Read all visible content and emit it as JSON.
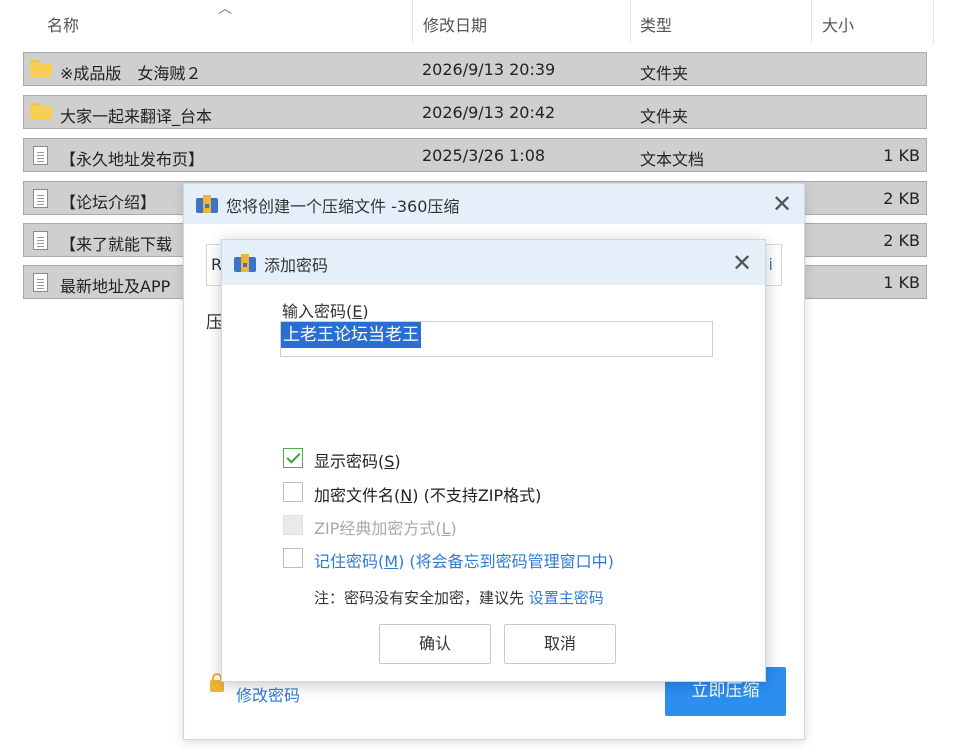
{
  "explorer": {
    "columns": {
      "name": "名称",
      "modified": "修改日期",
      "type": "类型",
      "size": "大小"
    },
    "files": [
      {
        "icon": "folder-icon",
        "name": "※成品版　女海贼２",
        "modified": "2026/9/13 20:39",
        "type": "文件夹",
        "size": ""
      },
      {
        "icon": "folder-icon",
        "name": "大家一起来翻译_台本",
        "modified": "2026/9/13 20:42",
        "type": "文件夹",
        "size": ""
      },
      {
        "icon": "document-icon",
        "name": "【永久地址发布页】",
        "modified": "2025/3/26 1:08",
        "type": "文本文档",
        "size": "1 KB"
      },
      {
        "icon": "document-icon",
        "name": "【论坛介绍】",
        "modified": "",
        "type": "",
        "size": "2 KB"
      },
      {
        "icon": "document-icon",
        "name": "【来了就能下载",
        "modified": "",
        "type": "",
        "size": "2 KB"
      },
      {
        "icon": "document-icon",
        "name": "最新地址及APP",
        "modified": "",
        "type": "",
        "size": "1 KB"
      }
    ]
  },
  "compress_dialog": {
    "title": "您将创建一个压缩文件 -360压缩",
    "input_visible_start": "R",
    "input_visible_end": "i",
    "side_label_fragment": "压",
    "change_password_link": "修改密码",
    "compress_now_button": "立即压缩"
  },
  "password_dialog": {
    "title": "添加密码",
    "password_label": "输入密码",
    "password_label_key": "E",
    "password_value": "上老王论坛当老王",
    "options": {
      "show_password": {
        "label": "显示密码",
        "key": "S",
        "checked": true
      },
      "encrypt_filenames": {
        "label": "加密文件名",
        "key": "N",
        "suffix": " (不支持ZIP格式)",
        "checked": false
      },
      "zip_classic": {
        "label": "ZIP经典加密方式",
        "key": "L",
        "checked": false,
        "disabled": true
      },
      "remember_password": {
        "label": "记住密码",
        "key": "M",
        "suffix": " (将会备忘到密码管理窗口中)",
        "checked": false
      }
    },
    "note_text": "注：密码没有安全加密，建议先 ",
    "note_link": "设置主密码",
    "ok_button": "确认",
    "cancel_button": "取消"
  },
  "colors": {
    "accent": "#2c8ff0",
    "link": "#2e7bd1",
    "title_bar": "#e4effa",
    "selection": "#2a6ed1"
  }
}
